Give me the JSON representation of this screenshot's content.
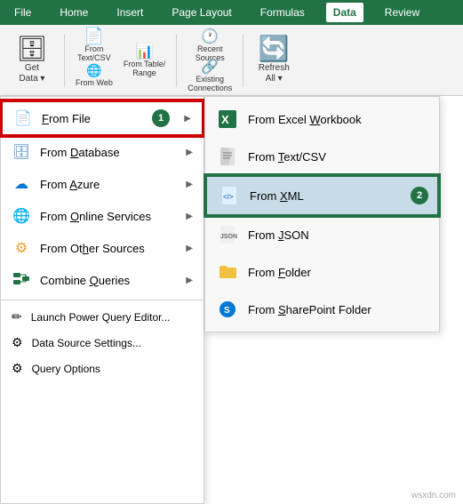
{
  "ribbon": {
    "tabs": [
      "File",
      "Home",
      "Insert",
      "Page Layout",
      "Formulas",
      "Data",
      "Review"
    ],
    "active_tab": "Data"
  },
  "toolbar": {
    "buttons": [
      {
        "id": "get-data",
        "label": "Get\nData",
        "icon": "🗄",
        "has_arrow": true
      },
      {
        "id": "from-text-csv",
        "label": "From\nText/CSV",
        "icon": "📄"
      },
      {
        "id": "from-web",
        "label": "From\nWeb",
        "icon": "🌐"
      },
      {
        "id": "from-table-range",
        "label": "From Table/\nRange",
        "icon": "📊"
      },
      {
        "id": "recent-sources",
        "label": "Recent\nSources",
        "icon": "🕐"
      },
      {
        "id": "existing-connections",
        "label": "Existing\nConnections",
        "icon": "🔗"
      },
      {
        "id": "refresh-all",
        "label": "Refresh\nAll",
        "icon": "🔄"
      }
    ]
  },
  "left_menu": {
    "items": [
      {
        "id": "from-file",
        "label": "From File",
        "icon": "📄",
        "has_arrow": true,
        "highlighted": true,
        "badge": "1",
        "underline_index": 5
      },
      {
        "id": "from-database",
        "label": "From Database",
        "icon": "🗄",
        "has_arrow": true,
        "underline_index": 5
      },
      {
        "id": "from-azure",
        "label": "From Azure",
        "icon": "☁",
        "has_arrow": true,
        "underline_index": 5
      },
      {
        "id": "from-online-services",
        "label": "From Online Services",
        "icon": "🌐",
        "has_arrow": true,
        "underline_index": 5
      },
      {
        "id": "from-other-sources",
        "label": "From Other Sources",
        "icon": "⚙",
        "has_arrow": true,
        "underline_index": 5
      },
      {
        "id": "combine-queries",
        "label": "Combine Queries",
        "icon": "📋",
        "has_arrow": true
      }
    ],
    "bottom_items": [
      {
        "id": "launch-power-query",
        "label": "Launch Power Query Editor...",
        "icon": "✏"
      },
      {
        "id": "data-source-settings",
        "label": "Data Source Settings...",
        "icon": "⚙"
      },
      {
        "id": "query-options",
        "label": "Query Options",
        "icon": "⚙"
      }
    ]
  },
  "right_menu": {
    "items": [
      {
        "id": "from-excel-workbook",
        "label": "From Excel Workbook",
        "icon_type": "excel"
      },
      {
        "id": "from-text-csv",
        "label": "From Text/CSV",
        "icon_type": "text"
      },
      {
        "id": "from-xml",
        "label": "From XML",
        "icon_type": "xml",
        "highlighted": true,
        "badge": "2",
        "underline_index": 5
      },
      {
        "id": "from-json",
        "label": "From JSON",
        "icon_type": "json"
      },
      {
        "id": "from-folder",
        "label": "From Folder",
        "icon_type": "folder"
      },
      {
        "id": "from-sharepoint-folder",
        "label": "From SharePoint Folder",
        "icon_type": "sharepoint"
      }
    ]
  },
  "watermark": "wsxdn.com"
}
